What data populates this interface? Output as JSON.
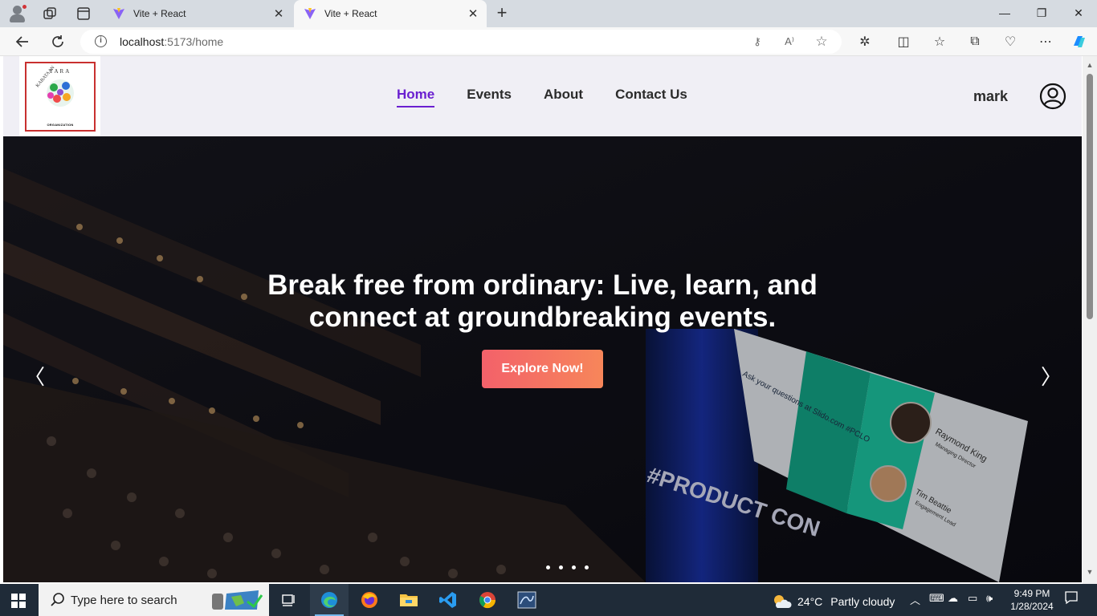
{
  "browser": {
    "tabs": [
      {
        "title": "Vite + React",
        "active": false
      },
      {
        "title": "Vite + React",
        "active": true
      }
    ],
    "url_host": "localhost",
    "url_path": ":5173/home"
  },
  "navbar": {
    "logo_top_text": "TARA",
    "logo_side_text": "KABATAAN",
    "logo_bottom_text": "ORGANIZATION",
    "links": [
      "Home",
      "Events",
      "About",
      "Contact Us"
    ],
    "active_link": "Home",
    "username": "mark"
  },
  "hero": {
    "heading_line1": "Break free from ordinary: Live, learn, and",
    "heading_line2": "connect at groundbreaking events.",
    "cta_label": "Explore Now!",
    "prev_arrow": "〈",
    "next_arrow": "〉",
    "slide_count": 4,
    "screen_title": "#PRODUCT CON",
    "screen_text": "Ask your questions at Slido.com #PCLO",
    "speaker1_name": "Raymond King",
    "speaker1_title": "Managing Director",
    "speaker2_name": "Tim Beattie",
    "speaker2_title": "Engagement Lead"
  },
  "taskbar": {
    "search_placeholder": "Type here to search",
    "weather_temp": "24°C",
    "weather_desc": "Partly cloudy",
    "time": "9:49 PM",
    "date": "1/28/2024"
  },
  "colors": {
    "accent": "#6a1fd0",
    "cta_start": "#f3616a",
    "cta_end": "#f7865a",
    "logo_border": "#c8302f",
    "taskbar": "#1f2b38"
  }
}
